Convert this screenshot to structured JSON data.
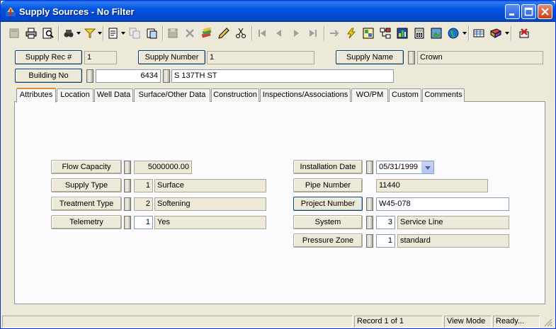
{
  "window": {
    "title": "Supply Sources - No Filter"
  },
  "header": {
    "supply_rec_label": "Supply Rec #",
    "supply_rec_value": "1",
    "supply_number_label": "Supply Number",
    "supply_number_value": "1",
    "supply_name_label": "Supply Name",
    "supply_name_value": "Crown",
    "building_no_label": "Building No",
    "building_no_value": "6434",
    "street_value": "S 137TH ST"
  },
  "tabs": [
    {
      "label": "Attributes"
    },
    {
      "label": "Location"
    },
    {
      "label": "Well Data"
    },
    {
      "label": "Surface/Other Data"
    },
    {
      "label": "Construction"
    },
    {
      "label": "Inspections/Associations"
    },
    {
      "label": "WO/PM"
    },
    {
      "label": "Custom"
    },
    {
      "label": "Comments"
    }
  ],
  "attributes": {
    "flow_capacity_label": "Flow Capacity",
    "flow_capacity_value": "5000000.00",
    "supply_type_label": "Supply Type",
    "supply_type_code": "1",
    "supply_type_value": "Surface",
    "treatment_type_label": "Treatment Type",
    "treatment_type_code": "2",
    "treatment_type_value": "Softening",
    "telemetry_label": "Telemetry",
    "telemetry_code": "1",
    "telemetry_value": "Yes",
    "installation_date_label": "Installation Date",
    "installation_date_value": "05/31/1999",
    "pipe_number_label": "Pipe Number",
    "pipe_number_value": "11440",
    "project_number_label": "Project Number",
    "project_number_value": "W45-078",
    "system_label": "System",
    "system_code": "3",
    "system_value": "Service Line",
    "pressure_zone_label": "Pressure Zone",
    "pressure_zone_code": "1",
    "pressure_zone_value": "standard"
  },
  "status": {
    "record": "Record 1 of 1",
    "mode": "View Mode",
    "state": "Ready..."
  },
  "colors": {
    "titlebar": "#0053e0",
    "window_bg": "#ece9d8",
    "active_tab_accent": "#e68b2c"
  },
  "icons": [
    "app-icon",
    "minimize-icon",
    "maximize-icon",
    "close-icon",
    "new-record-icon",
    "print-icon",
    "print-preview-icon",
    "search-icon",
    "filter-icon",
    "report-icon",
    "copy-icon",
    "paste-icon",
    "save-icon",
    "delete-icon",
    "edit-icon",
    "pencil-icon",
    "cut-icon",
    "first-record-icon",
    "previous-record-icon",
    "next-record-icon",
    "last-record-icon",
    "goto-icon",
    "lightning-icon",
    "map-icon",
    "network-icon",
    "chart-icon",
    "calculator-icon",
    "gis-icon",
    "globe-icon",
    "spreadsheet-icon",
    "book-icon",
    "exit-icon"
  ]
}
